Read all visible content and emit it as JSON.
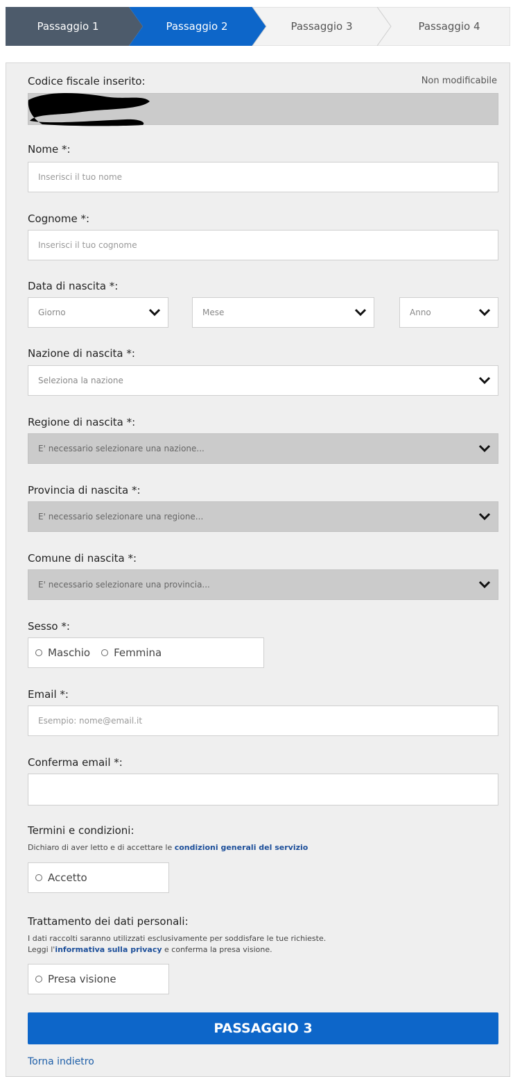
{
  "stepper": {
    "steps": [
      "Passaggio 1",
      "Passaggio 2",
      "Passaggio 3",
      "Passaggio 4"
    ],
    "active_index": 1,
    "colors": {
      "done": "#4d5b6b",
      "active": "#0d66c9",
      "pending": "#f3f3f3"
    }
  },
  "form": {
    "codice_fiscale": {
      "label": "Codice fiscale inserito:",
      "note": "Non modificabile"
    },
    "nome": {
      "label": "Nome *:",
      "placeholder": "Inserisci il tuo nome"
    },
    "cognome": {
      "label": "Cognome *:",
      "placeholder": "Inserisci il tuo cognome"
    },
    "data_nascita": {
      "label": "Data di nascita *:",
      "giorno": "Giorno",
      "mese": "Mese",
      "anno": "Anno"
    },
    "nazione": {
      "label": "Nazione di nascita *:",
      "value": "Seleziona la nazione"
    },
    "regione": {
      "label": "Regione di nascita *:",
      "value": "E' necessario selezionare una nazione..."
    },
    "provincia": {
      "label": "Provincia di nascita *:",
      "value": "E' necessario selezionare una regione..."
    },
    "comune": {
      "label": "Comune di nascita *:",
      "value": "E' necessario selezionare una provincia..."
    },
    "sesso": {
      "label": "Sesso *:",
      "options": [
        "Maschio",
        "Femmina"
      ]
    },
    "email": {
      "label": "Email *:",
      "placeholder": "Esempio: nome@email.it"
    },
    "conferma_email": {
      "label": "Conferma email *:",
      "placeholder": ""
    },
    "termini": {
      "label": "Termini e condizioni:",
      "text_prefix": "Dichiaro di aver letto e di accettare le ",
      "link": "condizioni generali del servizio",
      "option": "Accetto"
    },
    "privacy": {
      "label": "Trattamento dei dati personali:",
      "line1": "I dati raccolti saranno utilizzati esclusivamente per soddisfare le tue richieste.",
      "line2_prefix": "Leggi l'",
      "link": "informativa sulla privacy",
      "line2_suffix": " e conferma la presa visione.",
      "option": "Presa visione"
    }
  },
  "actions": {
    "next": "PASSAGGIO 3",
    "back": "Torna indietro"
  }
}
